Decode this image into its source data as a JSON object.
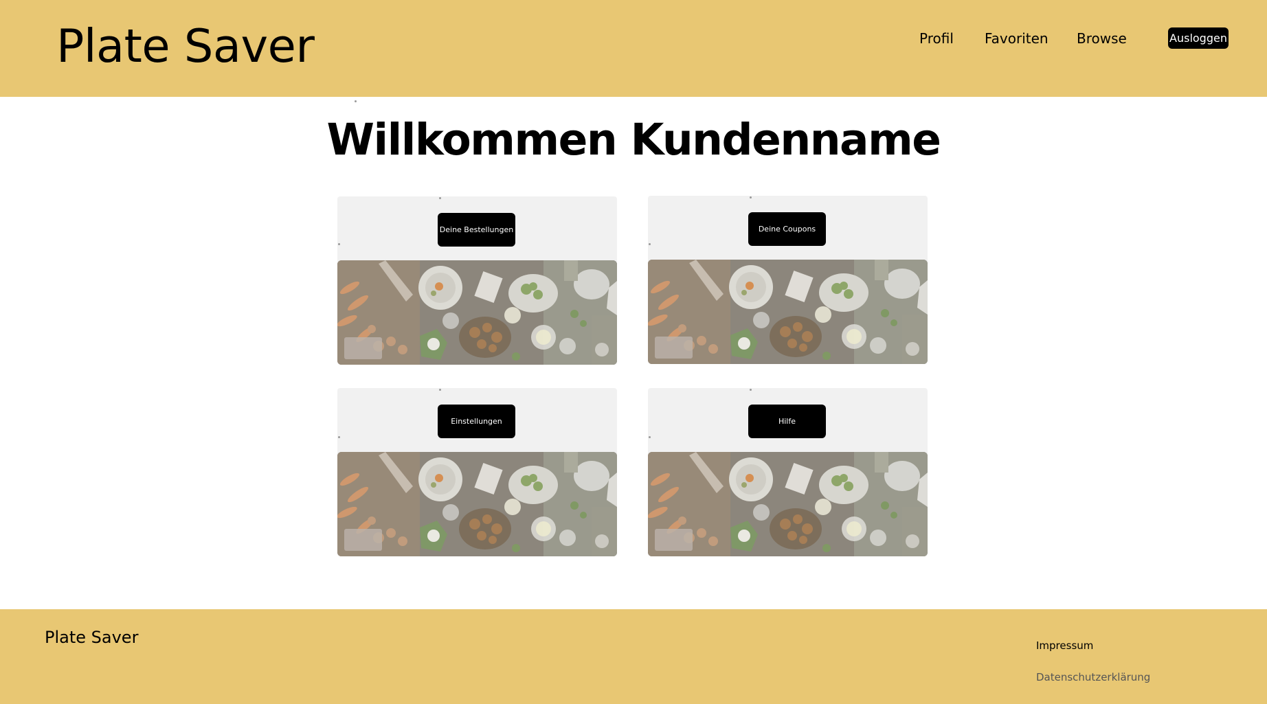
{
  "header": {
    "brand": "Plate Saver",
    "nav": [
      {
        "label": "Profil"
      },
      {
        "label": "Favoriten"
      },
      {
        "label": "Browse"
      }
    ],
    "logout_label": "Ausloggen"
  },
  "main": {
    "welcome_title": "Willkommen Kundenname",
    "cards": [
      {
        "button_label": "Deine Bestellungen",
        "image": "food-table-photo"
      },
      {
        "button_label": "Deine Coupons",
        "image": "food-table-photo"
      },
      {
        "button_label": "Einstellungen",
        "image": "food-table-photo"
      },
      {
        "button_label": "Hilfe",
        "image": "food-table-photo"
      }
    ]
  },
  "footer": {
    "brand": "Plate Saver",
    "links": [
      {
        "label": "Impressum"
      },
      {
        "label": "Datenschutzerklärung"
      }
    ]
  },
  "colors": {
    "header_bg": "#e8c773",
    "footer_bg": "#e8c773",
    "button_bg": "#000000",
    "card_bg": "#f1f1f1"
  }
}
